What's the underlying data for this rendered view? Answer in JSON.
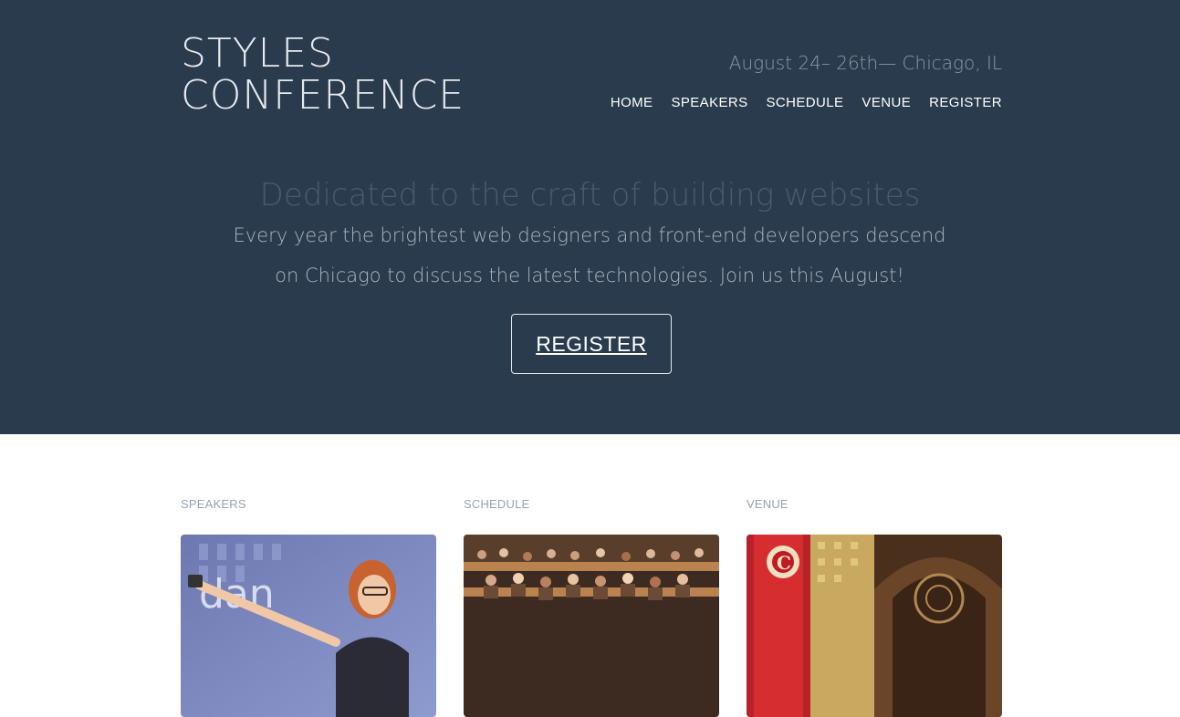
{
  "header": {
    "logo_line1": "STYLES",
    "logo_line2": "CONFERENCE",
    "tagline": "August 24– 26th— Chicago, IL",
    "nav": [
      "HOME",
      "SPEAKERS",
      "SCHEDULE",
      "VENUE",
      "REGISTER"
    ]
  },
  "hero": {
    "headline": "Dedicated to the craft of building websites",
    "lead": "Every year the brightest web designers and front-end developers descend on Chicago to discuss the latest technologies. Join us this August!",
    "cta_label": "REGISTER"
  },
  "features": [
    {
      "title": "SPEAKERS",
      "image": "speaker-photo"
    },
    {
      "title": "SCHEDULE",
      "image": "audience-photo"
    },
    {
      "title": "VENUE",
      "image": "theater-photo"
    }
  ],
  "colors": {
    "hero_bg": "#2a3b4e",
    "page_bg": "#ffffff",
    "muted_text": "#9aa3ad"
  }
}
